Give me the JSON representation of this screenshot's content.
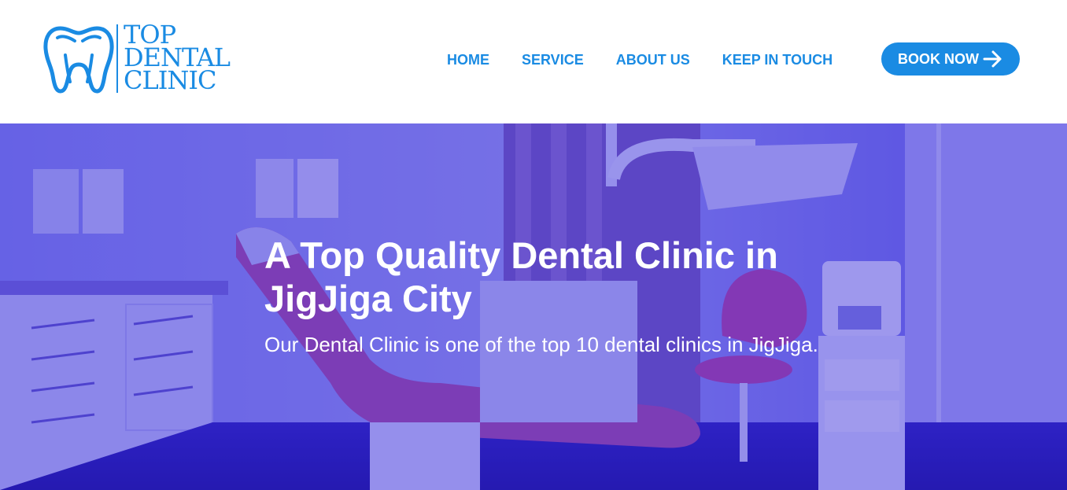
{
  "brand": {
    "line1": "TOP",
    "line2": "DENTAL",
    "line3": "CLINIC",
    "color": "#1a8be3"
  },
  "nav": {
    "items": [
      {
        "label": "HOME"
      },
      {
        "label": "SERVICE"
      },
      {
        "label": "ABOUT US"
      },
      {
        "label": "KEEP IN TOUCH"
      }
    ],
    "cta_label": "BOOK NOW",
    "cta_icon": "arrow-right-icon"
  },
  "hero": {
    "title": "A Top Quality Dental Clinic in JigJiga City",
    "subtitle": "Our Dental Clinic is one of the top 10 dental clinics in JigJiga.",
    "overlay_color": "#3024d7"
  }
}
